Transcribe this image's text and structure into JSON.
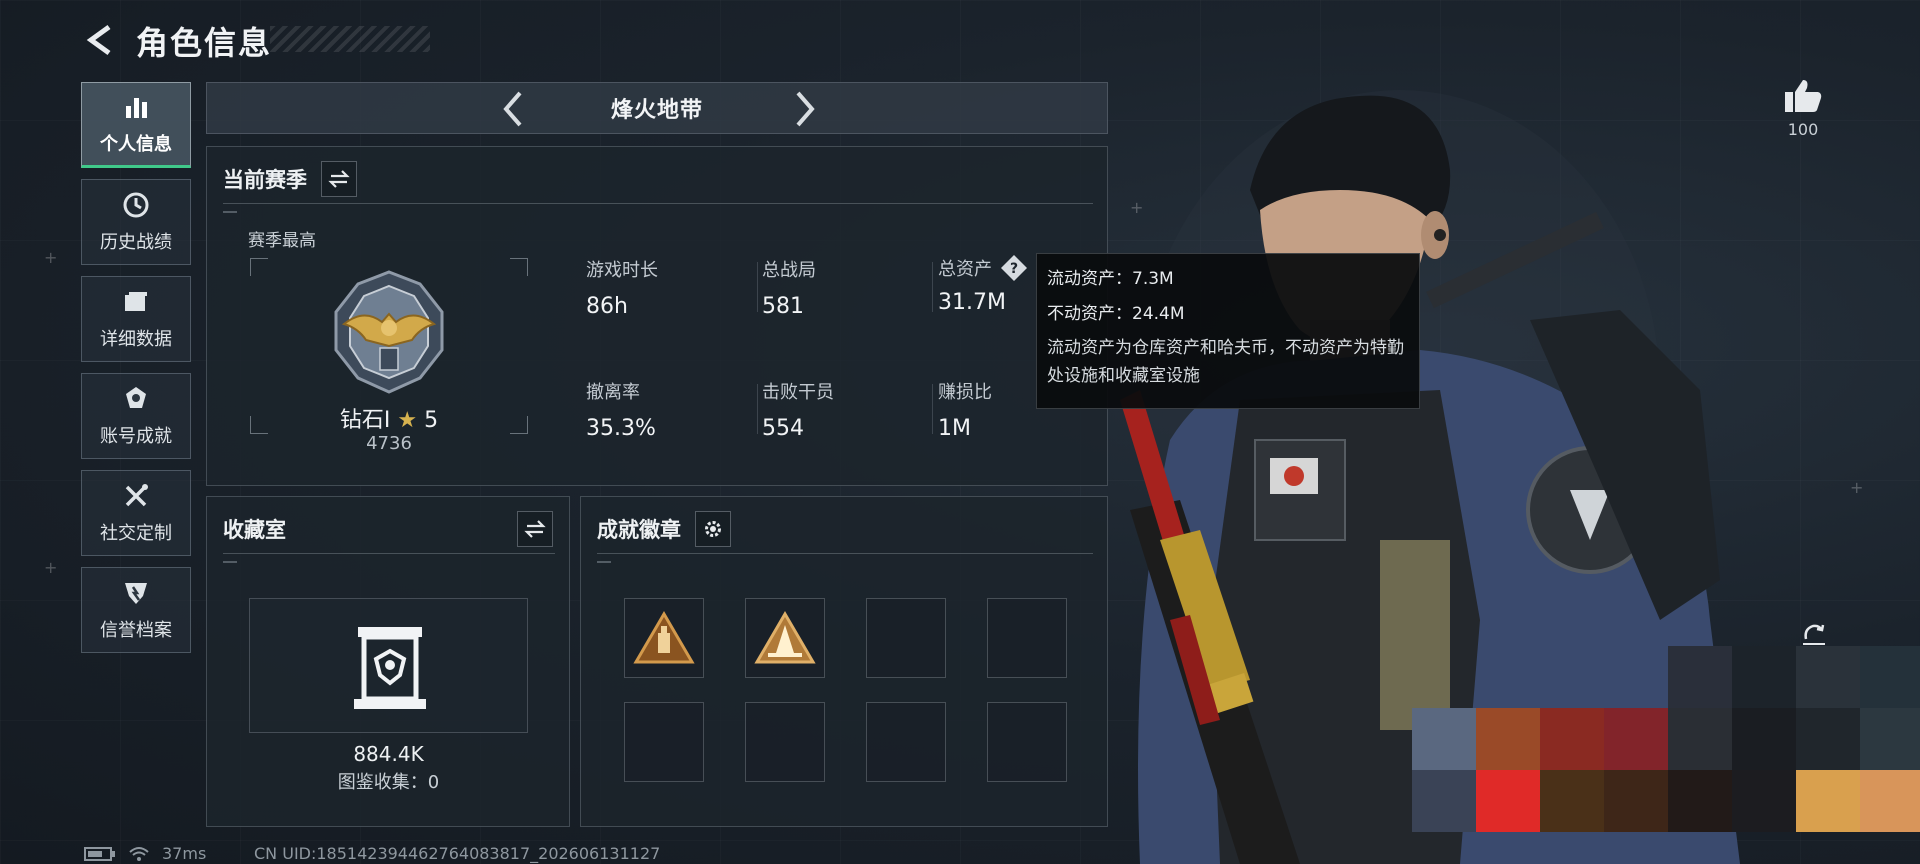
{
  "header": {
    "title": "角色信息",
    "back_icon": "back-arrow-icon"
  },
  "sidebar": {
    "items": [
      {
        "label": "个人信息",
        "icon": "bar-chart-icon",
        "active": true
      },
      {
        "label": "历史战绩",
        "icon": "history-clock-icon",
        "active": false
      },
      {
        "label": "详细数据",
        "icon": "folder-icon",
        "active": false
      },
      {
        "label": "账号成就",
        "icon": "achievement-icon",
        "active": false
      },
      {
        "label": "社交定制",
        "icon": "tools-icon",
        "active": false
      },
      {
        "label": "信誉档案",
        "icon": "reputation-shield-icon",
        "active": false
      }
    ],
    "active_color": "#40c98a"
  },
  "mode": {
    "title": "烽火地带"
  },
  "season": {
    "title": "当前赛季",
    "best_label": "赛季最高",
    "rank_name": "钻石I",
    "rank_stars": "5",
    "rank_score": "4736",
    "stats": [
      {
        "label": "游戏时长",
        "value": "86h"
      },
      {
        "label": "总战局",
        "value": "581"
      },
      {
        "label": "总资产",
        "value": "31.7M"
      },
      {
        "label": "撤离率",
        "value": "35.3%"
      },
      {
        "label": "击败干员",
        "value": "554"
      },
      {
        "label": "赚损比",
        "value": "1M"
      }
    ]
  },
  "tooltip": {
    "liquid": "流动资产：7.3M",
    "fixed": "不动资产：24.4M",
    "description": "流动资产为仓库资产和哈夫币，不动资产为特勤处设施和收藏室设施"
  },
  "collection": {
    "title": "收藏室",
    "value": "884.4K",
    "catalog": "图鉴收集：0"
  },
  "badges": {
    "title": "成就徽章",
    "slots_filled": 2,
    "slots_total": 8
  },
  "like": {
    "count": "100"
  },
  "footer": {
    "ping": "37ms",
    "uid": "CN UID:18514239446276408381​7_202606131127"
  }
}
